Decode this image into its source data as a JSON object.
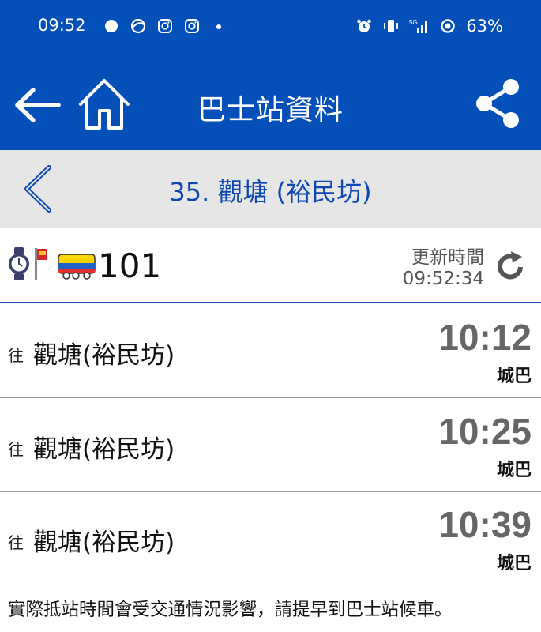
{
  "status_bar": {
    "time": "09:52",
    "battery": "63%"
  },
  "app_bar": {
    "title": "巴士站資料"
  },
  "stop": {
    "name": "35. 觀塘 (裕民坊)"
  },
  "route": {
    "number": "101",
    "update_label": "更新時間",
    "update_time": "09:52:34"
  },
  "etas": [
    {
      "prefix": "往",
      "destination": "觀塘(裕民坊)",
      "time": "10:12",
      "operator": "城巴"
    },
    {
      "prefix": "往",
      "destination": "觀塘(裕民坊)",
      "time": "10:25",
      "operator": "城巴"
    },
    {
      "prefix": "往",
      "destination": "觀塘(裕民坊)",
      "time": "10:39",
      "operator": "城巴"
    }
  ],
  "notice": "實際抵站時間會受交通情況影響，請提早到巴士站候車。",
  "colors": {
    "brand_blue": "#0550b8",
    "stop_text_blue": "#0d47b0",
    "stopbar_bg": "#e6e6e6",
    "eta_gray": "#666666"
  }
}
